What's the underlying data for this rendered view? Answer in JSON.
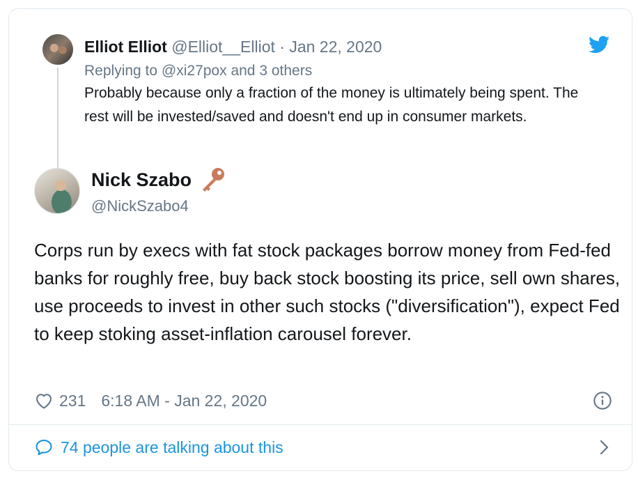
{
  "colors": {
    "accent": "#1b95e0",
    "muted": "#657786",
    "text": "#14171a",
    "border": "#e1e8ed",
    "key": "#c97c5d"
  },
  "icons": {
    "logo": "twitter-bird-icon",
    "like": "heart-icon",
    "info": "info-icon",
    "conversation": "speech-bubble-icon",
    "more": "chevron-right-icon",
    "badge": "key-icon"
  },
  "reply_tweet": {
    "name": "Elliot Elliot",
    "handle": "@Elliot__Elliot",
    "separator": "·",
    "date": "Jan 22, 2020",
    "replying_prefix": "Replying to",
    "replying_handle": "@xi27pox",
    "replying_suffix": "and 3 others",
    "text": "Probably because only a fraction of the money is ultimately being spent. The rest will be invested/saved and doesn't end up in consumer markets."
  },
  "main_tweet": {
    "name": "Nick Szabo",
    "handle": "@NickSzabo4",
    "text": "Corps run by execs with fat stock packages borrow money from Fed-fed banks for roughly free, buy back stock boosting its price, sell own shares, use proceeds to invest in other such stocks (\"diversification\"), expect Fed to keep stoking asset-inflation carousel forever.",
    "like_count": "231",
    "timestamp": "6:18 AM - Jan 22, 2020"
  },
  "footer": {
    "talking_text": "74 people are talking about this"
  }
}
